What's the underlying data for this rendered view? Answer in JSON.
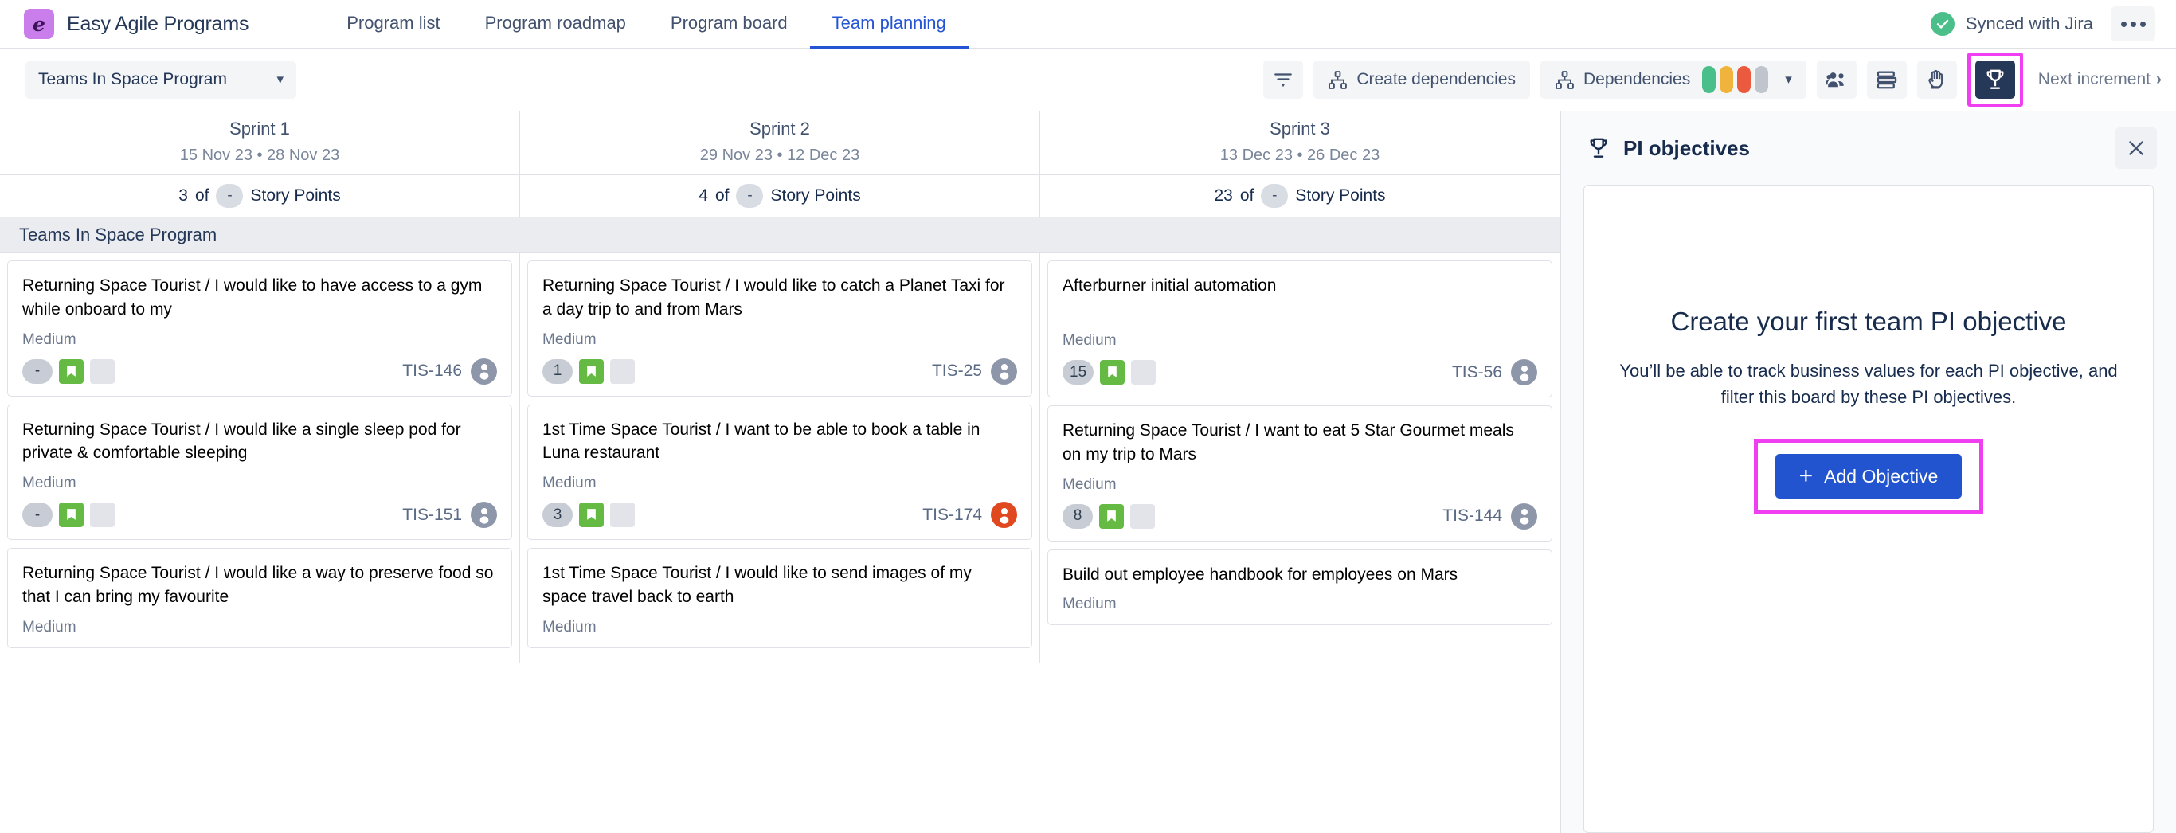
{
  "header": {
    "brand_logo_glyph": "e",
    "brand_name": "Easy Agile Programs",
    "tabs": [
      {
        "label": "Program list",
        "active": false
      },
      {
        "label": "Program roadmap",
        "active": false
      },
      {
        "label": "Program board",
        "active": false
      },
      {
        "label": "Team planning",
        "active": true
      }
    ],
    "sync_label": "Synced with Jira",
    "more_label": "•••"
  },
  "toolbar": {
    "program_select_value": "Teams In Space Program",
    "chevron": "▾",
    "filter_label": "filter-icon",
    "create_dependencies_label": "Create dependencies",
    "dependencies_label": "Dependencies",
    "dependency_swatches": [
      "#4bbf8a",
      "#f0b43c",
      "#eb5a3e",
      "#bfc4cd"
    ],
    "teams_label": "teams-icon",
    "stack_label": "stack-icon",
    "hand_label": "hand-icon",
    "pi_objectives_label": "trophy-icon",
    "next_increment_label": "Next increment",
    "next_increment_chevron": "›"
  },
  "board": {
    "sprints": [
      {
        "name": "Sprint 1",
        "dates": "15 Nov 23 • 28 Nov 23",
        "points_done": "3",
        "points_of": "of",
        "points_total": "-",
        "points_suffix": "Story Points"
      },
      {
        "name": "Sprint 2",
        "dates": "29 Nov 23 • 12 Dec 23",
        "points_done": "4",
        "points_of": "of",
        "points_total": "-",
        "points_suffix": "Story Points"
      },
      {
        "name": "Sprint 3",
        "dates": "13 Dec 23 • 26 Dec 23",
        "points_done": "23",
        "points_of": "of",
        "points_total": "-",
        "points_suffix": "Story Points"
      }
    ],
    "swimlane_label": "Teams In Space Program",
    "columns": [
      {
        "cards": [
          {
            "title": "Returning Space Tourist / I would like to have access to a gym while onboard to my",
            "priority": "Medium",
            "estimate": "-",
            "key": "TIS-146",
            "avatar_color": "#8d97a9"
          },
          {
            "title": "Returning Space Tourist / I would like a single sleep pod for private & comfortable sleeping",
            "priority": "Medium",
            "estimate": "-",
            "key": "TIS-151",
            "avatar_color": "#8d97a9"
          },
          {
            "title": "Returning Space Tourist / I would like a way to preserve food so that I can bring my favourite",
            "priority": "Medium",
            "estimate": "",
            "key": "",
            "avatar_color": "#8d97a9"
          }
        ]
      },
      {
        "cards": [
          {
            "title": "Returning Space Tourist / I would like to catch a Planet Taxi for a day trip to and from Mars",
            "priority": "Medium",
            "estimate": "1",
            "key": "TIS-25",
            "avatar_color": "#8d97a9"
          },
          {
            "title": "1st Time Space Tourist / I want to be able to book a table in Luna restaurant",
            "priority": "Medium",
            "estimate": "3",
            "key": "TIS-174",
            "avatar_color": "#e0481f"
          },
          {
            "title": "1st Time Space Tourist / I would like to send images of my space travel back to earth",
            "priority": "Medium",
            "estimate": "",
            "key": "",
            "avatar_color": "#8d97a9"
          }
        ]
      },
      {
        "cards": [
          {
            "title": "Afterburner initial automation",
            "priority": "Medium",
            "estimate": "15",
            "key": "TIS-56",
            "avatar_color": "#8d97a9"
          },
          {
            "title": "Returning Space Tourist / I want to eat 5 Star Gourmet meals on my trip to Mars",
            "priority": "Medium",
            "estimate": "8",
            "key": "TIS-144",
            "avatar_color": "#8d97a9"
          },
          {
            "title": "Build out employee handbook for employees on Mars",
            "priority": "Medium",
            "estimate": "",
            "key": "",
            "avatar_color": "#8d97a9"
          }
        ]
      }
    ]
  },
  "panel": {
    "title": "PI objectives",
    "close_label": "✕",
    "empty_title": "Create your first team PI objective",
    "empty_desc": "You’ll be able to track business values for each PI objective, and filter this board by these PI objectives.",
    "add_button_label": "Add Objective",
    "add_button_plus": "+"
  },
  "colors": {
    "accent_blue": "#2655d4",
    "button_blue": "#2154ce",
    "highlight_magenta": "#ef3ff0",
    "dark_navy": "#253858",
    "green": "#65ba43"
  }
}
